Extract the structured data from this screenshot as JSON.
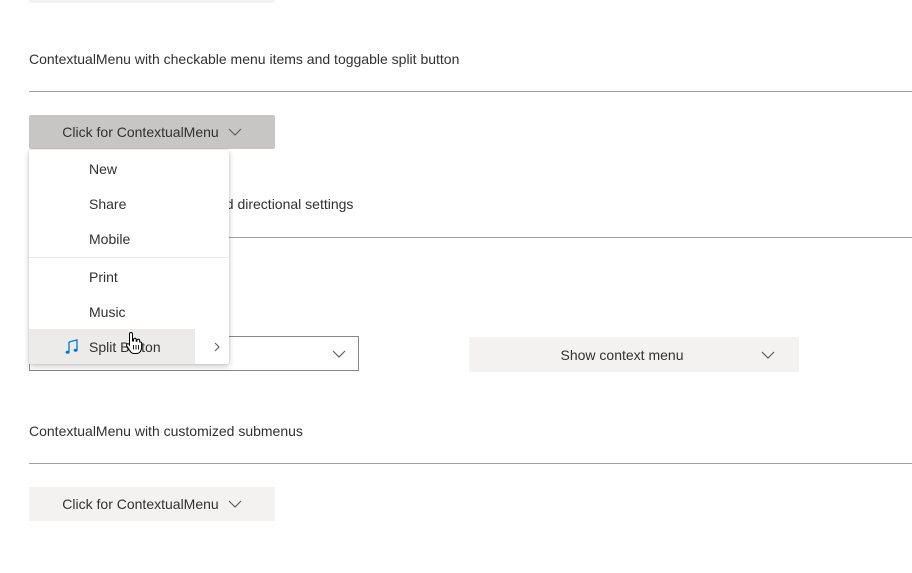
{
  "sections": {
    "checkable": {
      "title": "ContextualMenu with checkable menu items and toggable split button",
      "button_label": "Click for ContextualMenu"
    },
    "directional": {
      "title_partial": "nd directional settings"
    },
    "directional_controls": {
      "dropdown_value": "",
      "show_menu_label": "Show context menu"
    },
    "submenus": {
      "title": "ContextualMenu with customized submenus",
      "button_label": "Click for ContextualMenu"
    }
  },
  "menu": {
    "items": [
      {
        "label": "New"
      },
      {
        "label": "Share"
      },
      {
        "label": "Mobile"
      },
      {
        "label": "Print"
      },
      {
        "label": "Music"
      },
      {
        "label": "Split Button",
        "icon": "music-note-icon",
        "has_submenu": true
      }
    ]
  },
  "colors": {
    "icon_accent": "#0078d4",
    "button_bg": "#f3f2f1",
    "button_active_bg": "#c8c6c4",
    "split_hover_bg": "#edebe9"
  }
}
